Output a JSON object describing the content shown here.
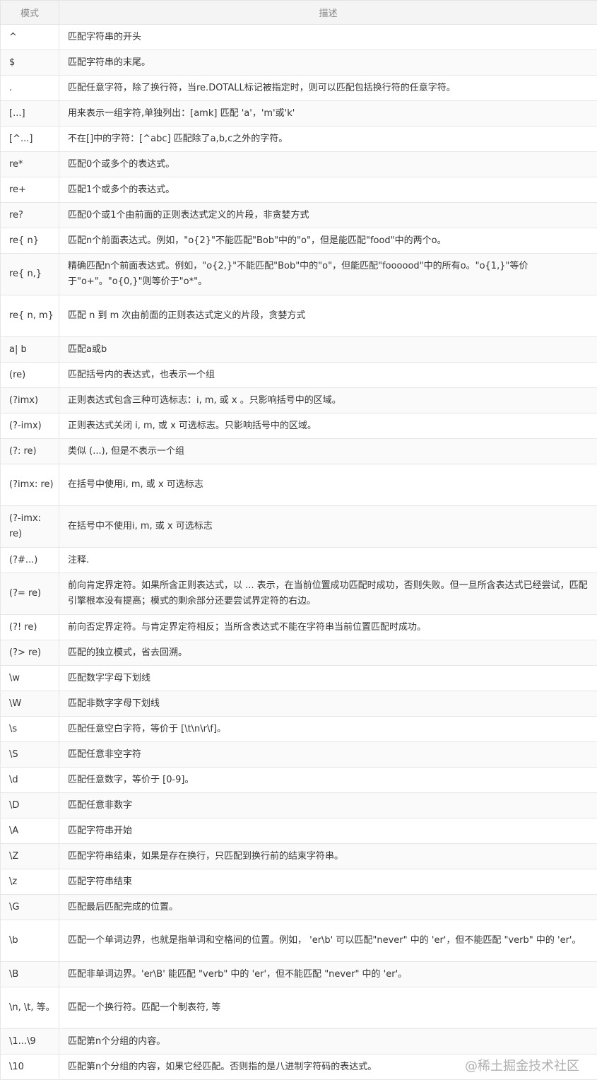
{
  "table": {
    "headers": [
      "模式",
      "描述"
    ],
    "rows": [
      {
        "pattern": "^",
        "desc": "匹配字符串的开头"
      },
      {
        "pattern": "$",
        "desc": "匹配字符串的末尾。"
      },
      {
        "pattern": ".",
        "desc": "匹配任意字符，除了换行符，当re.DOTALL标记被指定时，则可以匹配包括换行符的任意字符。"
      },
      {
        "pattern": "[...]",
        "desc": "用来表示一组字符,单独列出：[amk] 匹配 'a'，'m'或'k'"
      },
      {
        "pattern": "[^...]",
        "desc": "不在[]中的字符：[^abc] 匹配除了a,b,c之外的字符。"
      },
      {
        "pattern": "re*",
        "desc": "匹配0个或多个的表达式。"
      },
      {
        "pattern": "re+",
        "desc": "匹配1个或多个的表达式。"
      },
      {
        "pattern": "re?",
        "desc": "匹配0个或1个由前面的正则表达式定义的片段，非贪婪方式"
      },
      {
        "pattern": "re{ n}",
        "desc": "匹配n个前面表达式。例如，\"o{2}\"不能匹配\"Bob\"中的\"o\"，但是能匹配\"food\"中的两个o。"
      },
      {
        "pattern": "re{ n,}",
        "desc": "精确匹配n个前面表达式。例如，\"o{2,}\"不能匹配\"Bob\"中的\"o\"，但能匹配\"foooood\"中的所有o。\"o{1,}\"等价于\"o+\"。\"o{0,}\"则等价于\"o*\"。"
      },
      {
        "pattern": "re{ n, m}",
        "desc": "匹配 n 到 m 次由前面的正则表达式定义的片段，贪婪方式"
      },
      {
        "pattern": "a| b",
        "desc": "匹配a或b"
      },
      {
        "pattern": "(re)",
        "desc": "匹配括号内的表达式，也表示一个组"
      },
      {
        "pattern": "(?imx)",
        "desc": "正则表达式包含三种可选标志：i, m, 或 x 。只影响括号中的区域。"
      },
      {
        "pattern": "(?-imx)",
        "desc": "正则表达式关闭 i, m, 或 x 可选标志。只影响括号中的区域。"
      },
      {
        "pattern": "(?: re)",
        "desc": "类似 (...), 但是不表示一个组"
      },
      {
        "pattern": "(?imx: re)",
        "desc": "在括号中使用i, m, 或 x 可选标志"
      },
      {
        "pattern": "(?-imx: re)",
        "desc": "在括号中不使用i, m, 或 x 可选标志"
      },
      {
        "pattern": "(?#...)",
        "desc": "注释."
      },
      {
        "pattern": "(?= re)",
        "desc": "前向肯定界定符。如果所含正则表达式，以 ... 表示，在当前位置成功匹配时成功，否则失败。但一旦所含表达式已经尝试，匹配引擎根本没有提高；模式的剩余部分还要尝试界定符的右边。"
      },
      {
        "pattern": "(?! re)",
        "desc": "前向否定界定符。与肯定界定符相反；当所含表达式不能在字符串当前位置匹配时成功。"
      },
      {
        "pattern": "(?> re)",
        "desc": "匹配的独立模式，省去回溯。"
      },
      {
        "pattern": "\\w",
        "desc": "匹配数字字母下划线"
      },
      {
        "pattern": "\\W",
        "desc": "匹配非数字字母下划线"
      },
      {
        "pattern": "\\s",
        "desc": "匹配任意空白字符，等价于 [\\t\\n\\r\\f]。"
      },
      {
        "pattern": "\\S",
        "desc": "匹配任意非空字符"
      },
      {
        "pattern": "\\d",
        "desc": "匹配任意数字，等价于 [0-9]。"
      },
      {
        "pattern": "\\D",
        "desc": "匹配任意非数字"
      },
      {
        "pattern": "\\A",
        "desc": "匹配字符串开始"
      },
      {
        "pattern": "\\Z",
        "desc": "匹配字符串结束，如果是存在换行，只匹配到换行前的结束字符串。"
      },
      {
        "pattern": "\\z",
        "desc": "匹配字符串结束"
      },
      {
        "pattern": "\\G",
        "desc": "匹配最后匹配完成的位置。"
      },
      {
        "pattern": "\\b",
        "desc": "匹配一个单词边界，也就是指单词和空格间的位置。例如， 'er\\b' 可以匹配\"never\" 中的 'er'，但不能匹配 \"verb\" 中的 'er'。"
      },
      {
        "pattern": "\\B",
        "desc": "匹配非单词边界。'er\\B' 能匹配 \"verb\" 中的 'er'，但不能匹配 \"never\" 中的 'er'。"
      },
      {
        "pattern": "\\n, \\t, 等。",
        "desc": "匹配一个换行符。匹配一个制表符, 等"
      },
      {
        "pattern": "\\1...\\9",
        "desc": "匹配第n个分组的内容。"
      },
      {
        "pattern": "\\10",
        "desc": "匹配第n个分组的内容，如果它经匹配。否则指的是八进制字符码的表达式。"
      }
    ]
  },
  "watermark": "@稀土掘金技术社区"
}
